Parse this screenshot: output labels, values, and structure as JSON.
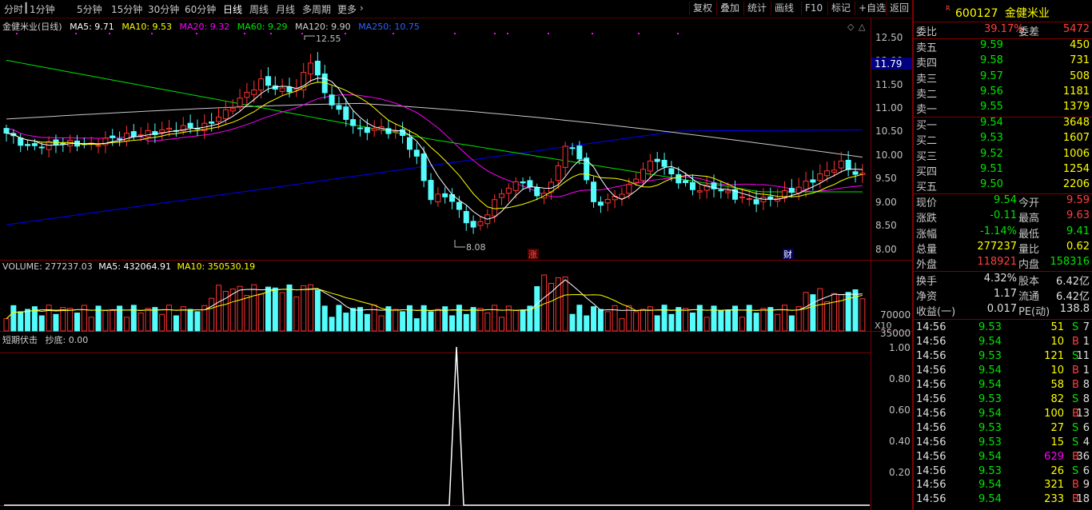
{
  "toolbar": {
    "periods": [
      "分时",
      "1分钟",
      "5分钟",
      "15分钟",
      "30分钟",
      "60分钟",
      "日线",
      "周线",
      "月线",
      "多周期",
      "更多"
    ],
    "active_period": "日线",
    "buttons": [
      "复权",
      "叠加",
      "统计",
      "画线",
      "F10",
      "标记",
      "+自选",
      "返回"
    ]
  },
  "legend_main": {
    "name": "金健米业(日线)",
    "ma5": "MA5: 9.71",
    "ma10": "MA10: 9.53",
    "ma20": "MA20: 9.32",
    "ma60": "MA60: 9.29",
    "ma120": "MA120: 9.90",
    "ma250": "MA250: 10.75"
  },
  "legend_volume": {
    "vol": "VOLUME: 277237.03",
    "ma5": "MA5: 432064.91",
    "ma10": "MA10: 350530.19"
  },
  "legend_ind": {
    "name": "短期伏击",
    "value": "抄底: 0.00"
  },
  "colors": {
    "up": "#ff3232",
    "down": "#54fcfc",
    "ma5": "#ffffff",
    "ma10": "#ffff00",
    "ma20": "#ff00ff",
    "ma60": "#00e600",
    "ma120": "#c8c8c8",
    "ma250": "#0000ff",
    "grid": "#800000"
  },
  "price_axis": [
    "12.50",
    "12.00",
    "11.50",
    "11.00",
    "10.50",
    "10.00",
    "9.50",
    "9.00",
    "8.50",
    "8.00"
  ],
  "price_marker": "11.79",
  "annotations": {
    "high": "12.55",
    "low": "8.08",
    "zhang": "涨",
    "cai": "财"
  },
  "volume_axis": [
    "70000",
    "35000"
  ],
  "volume_unit": "X10",
  "ind_axis": [
    "1.00",
    "0.80",
    "0.60",
    "0.40",
    "0.20"
  ],
  "quote": {
    "code": "600127",
    "name": "金健米业",
    "webi_label": "委比",
    "webi": "39.17%",
    "weicha_label": "委差",
    "weicha": "5472",
    "asks": [
      {
        "label": "卖五",
        "price": "9.59",
        "vol": "450"
      },
      {
        "label": "卖四",
        "price": "9.58",
        "vol": "731"
      },
      {
        "label": "卖三",
        "price": "9.57",
        "vol": "508"
      },
      {
        "label": "卖二",
        "price": "9.56",
        "vol": "1181"
      },
      {
        "label": "卖一",
        "price": "9.55",
        "vol": "1379"
      }
    ],
    "bids": [
      {
        "label": "买一",
        "price": "9.54",
        "vol": "3648"
      },
      {
        "label": "买二",
        "price": "9.53",
        "vol": "1607"
      },
      {
        "label": "买三",
        "price": "9.52",
        "vol": "1006"
      },
      {
        "label": "买四",
        "price": "9.51",
        "vol": "1254"
      },
      {
        "label": "买五",
        "price": "9.50",
        "vol": "2206"
      }
    ],
    "stats": [
      {
        "l1": "现价",
        "v1": "9.54",
        "l2": "今开",
        "v2": "9.59"
      },
      {
        "l1": "涨跌",
        "v1": "-0.11",
        "l2": "最高",
        "v2": "9.63"
      },
      {
        "l1": "涨幅",
        "v1": "-1.14%",
        "l2": "最低",
        "v2": "9.41"
      },
      {
        "l1": "总量",
        "v1": "277237",
        "l2": "量比",
        "v2": "0.62"
      },
      {
        "l1": "外盘",
        "v1": "118921",
        "l2": "内盘",
        "v2": "158316"
      }
    ],
    "stats2": [
      {
        "l1": "换手",
        "v1": "4.32%",
        "l2": "股本",
        "v2": "6.42亿"
      },
      {
        "l1": "净资",
        "v1": "1.17",
        "l2": "流通",
        "v2": "6.42亿"
      },
      {
        "l1": "收益(一)",
        "v1": "0.017",
        "l2": "PE(动)",
        "v2": "138.8"
      }
    ],
    "ticks": [
      {
        "t": "14:56",
        "p": "9.53",
        "v": "51",
        "bs": "S",
        "n": "7"
      },
      {
        "t": "14:56",
        "p": "9.54",
        "v": "10",
        "bs": "B",
        "n": "1"
      },
      {
        "t": "14:56",
        "p": "9.53",
        "v": "121",
        "bs": "S",
        "n": "11"
      },
      {
        "t": "14:56",
        "p": "9.54",
        "v": "10",
        "bs": "B",
        "n": "1"
      },
      {
        "t": "14:56",
        "p": "9.54",
        "v": "58",
        "bs": "B",
        "n": "8"
      },
      {
        "t": "14:56",
        "p": "9.53",
        "v": "82",
        "bs": "S",
        "n": "8"
      },
      {
        "t": "14:56",
        "p": "9.54",
        "v": "100",
        "bs": "B",
        "n": "13"
      },
      {
        "t": "14:56",
        "p": "9.53",
        "v": "27",
        "bs": "S",
        "n": "6"
      },
      {
        "t": "14:56",
        "p": "9.53",
        "v": "15",
        "bs": "S",
        "n": "4"
      },
      {
        "t": "14:56",
        "p": "9.54",
        "v": "629",
        "bs": "B",
        "n": "36"
      },
      {
        "t": "14:56",
        "p": "9.53",
        "v": "26",
        "bs": "S",
        "n": "6"
      },
      {
        "t": "14:56",
        "p": "9.54",
        "v": "321",
        "bs": "B",
        "n": "9"
      },
      {
        "t": "14:56",
        "p": "9.54",
        "v": "233",
        "bs": "B",
        "n": "18"
      }
    ]
  }
}
